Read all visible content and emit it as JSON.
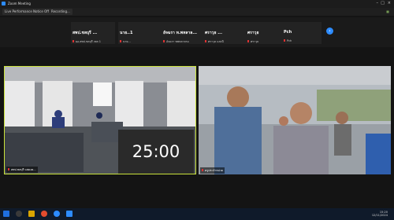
{
  "window": {
    "title": "Zoom Meeting"
  },
  "tabs": [
    {
      "label": "Live Performance Notice Off"
    },
    {
      "label": "Recording..."
    }
  ],
  "participants_strip": [
    {
      "name": "สพป.ชลบุรี ...",
      "sub": "ผอ.สพป.ชลบุรี เขต 1"
    },
    {
      "name": "นาย..1",
      "sub": "นาย..."
    },
    {
      "name": "อัจฉรา ท.พหลาล...",
      "sub": "อัจฉรา ทพหลาลรอ"
    },
    {
      "name": "ศราวุธ ...",
      "sub": "ศราวุธ แสงนี"
    },
    {
      "name": "ศราวุธ",
      "sub": "ศราวุธ"
    },
    {
      "name": "Pch",
      "sub": "Pch"
    }
  ],
  "videos": [
    {
      "name": "สพป.ชลบุรี แสดงค..."
    },
    {
      "name": "ครูประจำหน่วย"
    }
  ],
  "timer": "25:00",
  "taskbar": {
    "time": "15:20",
    "date": "12/11/2024"
  },
  "colors": {
    "active_speaker_border": "#c9e23b",
    "accent": "#2d8cff"
  }
}
